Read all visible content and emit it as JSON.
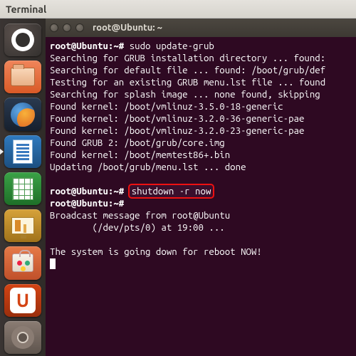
{
  "titlebar": {
    "title": "Terminal"
  },
  "launcher": {
    "items": [
      {
        "name": "dash"
      },
      {
        "name": "files"
      },
      {
        "name": "firefox"
      },
      {
        "name": "writer"
      },
      {
        "name": "calc"
      },
      {
        "name": "impress"
      },
      {
        "name": "software-center"
      },
      {
        "name": "ubuntu-one"
      },
      {
        "name": "settings"
      }
    ],
    "u_letter": "U"
  },
  "terminal": {
    "window_title": "root@Ubuntu: ~",
    "prompt": "root@Ubuntu:~#",
    "lines": {
      "cmd1": "sudo update-grub",
      "l1": "Searching for GRUB installation directory ... found:",
      "l2": "Searching for default file ... found: /boot/grub/def",
      "l3": "Testing for an existing GRUB menu.lst file ... found",
      "l4": "Searching for splash image ... none found, skipping",
      "l5": "Found kernel: /boot/vmlinuz-3.5.0-18-generic",
      "l6": "Found kernel: /boot/vmlinuz-3.2.0-36-generic-pae",
      "l7": "Found kernel: /boot/vmlinuz-3.2.0-23-generic-pae",
      "l8": "Found GRUB 2: /boot/grub/core.img",
      "l9": "Found kernel: /boot/memtest86+.bin",
      "l10": "Updating /boot/grub/menu.lst ... done",
      "cmd2": "shutdown -r now",
      "l11": "Broadcast message from root@Ubuntu",
      "l12": "        (/dev/pts/0) at 19:00 ...",
      "l13": "The system is going down for reboot NOW!"
    }
  }
}
